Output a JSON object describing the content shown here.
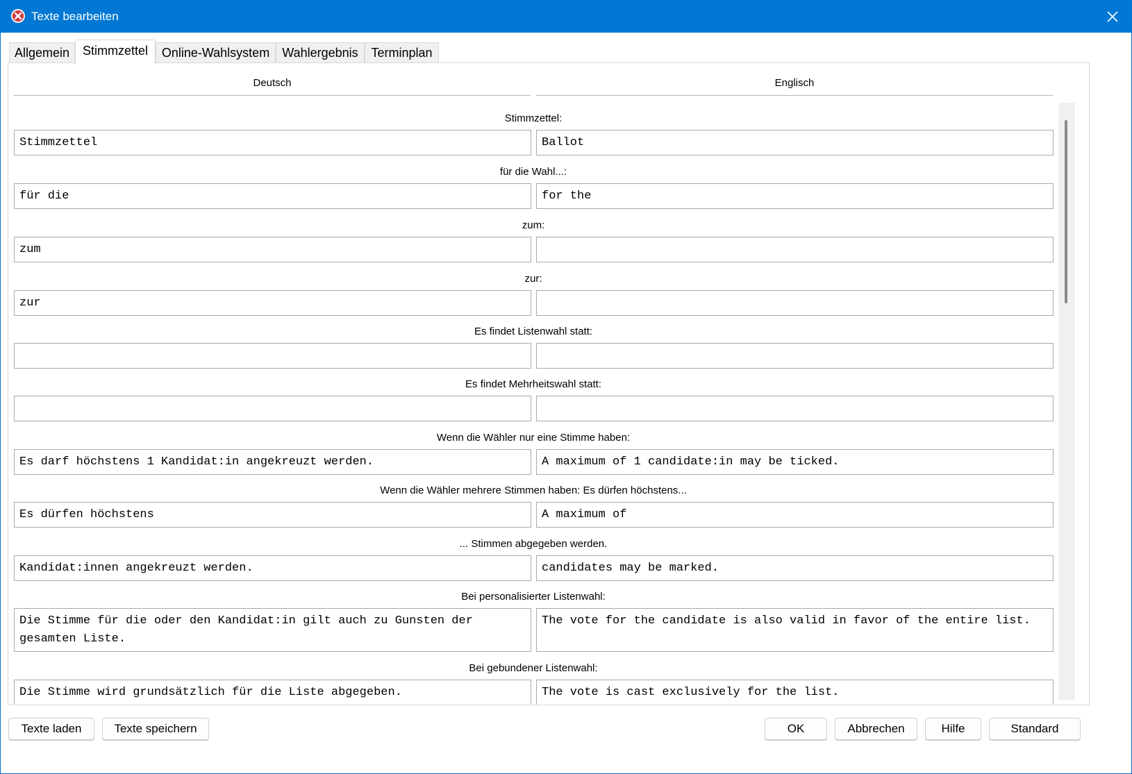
{
  "window": {
    "title": "Texte bearbeiten"
  },
  "tabs": [
    {
      "label": "Allgemein",
      "active": false
    },
    {
      "label": "Stimmzettel",
      "active": true
    },
    {
      "label": "Online-Wahlsystem",
      "active": false
    },
    {
      "label": "Wahlergebnis",
      "active": false
    },
    {
      "label": "Terminplan",
      "active": false
    }
  ],
  "columns": {
    "de": "Deutsch",
    "en": "Englisch"
  },
  "fields": [
    {
      "label": "Stimmzettel:",
      "de": "Stimmzettel",
      "en": "Ballot"
    },
    {
      "label": "für die Wahl...:",
      "de": "für die",
      "en": "for the"
    },
    {
      "label": "zum:",
      "de": "zum",
      "en": ""
    },
    {
      "label": "zur:",
      "de": "zur",
      "en": ""
    },
    {
      "label": "Es findet Listenwahl statt:",
      "de": "",
      "en": ""
    },
    {
      "label": "Es findet Mehrheitswahl statt:",
      "de": "",
      "en": ""
    },
    {
      "label": "Wenn die Wähler nur eine Stimme haben:",
      "de": "Es darf höchstens 1 Kandidat:in angekreuzt werden.",
      "en": "A maximum of 1 candidate:in may be ticked."
    },
    {
      "label": "Wenn die Wähler mehrere Stimmen haben:  Es dürfen höchstens...",
      "de": "Es dürfen höchstens",
      "en": "A maximum of"
    },
    {
      "label": "...  Stimmen abgegeben werden.",
      "de": "Kandidat:innen angekreuzt werden.",
      "en": "candidates may be marked."
    },
    {
      "label": "Bei personalisierter Listenwahl:",
      "de": "Die Stimme für die oder den Kandidat:in gilt auch zu Gunsten der gesamten Liste.",
      "en": "The vote for the candidate is also valid in favor of the entire list."
    },
    {
      "label": "Bei gebundener Listenwahl:",
      "de": "Die Stimme wird grundsätzlich für die Liste abgegeben.",
      "en": "The vote is cast exclusively for the list."
    }
  ],
  "buttons": {
    "load": "Texte laden",
    "save": "Texte speichern",
    "ok": "OK",
    "cancel": "Abbrechen",
    "help": "Hilfe",
    "default": "Standard"
  },
  "icons": {
    "app": "ballot-cross-icon",
    "close": "close-icon"
  },
  "colors": {
    "titlebar": "#0078d4",
    "app_icon": "#d9343b"
  }
}
